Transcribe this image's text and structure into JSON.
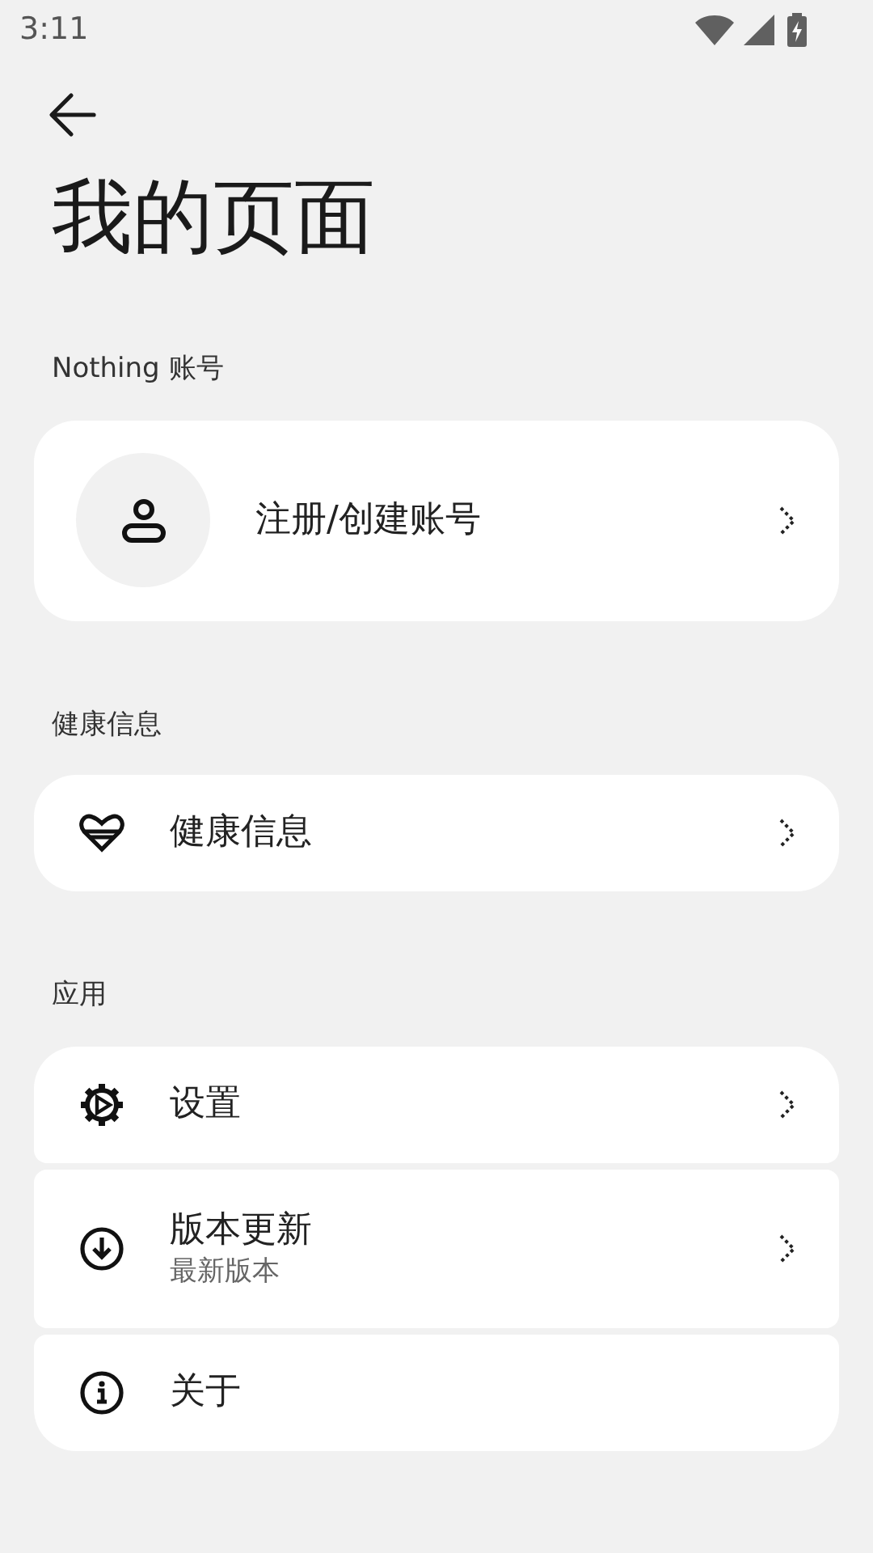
{
  "status_bar": {
    "time": "3:11"
  },
  "title": "我的页面",
  "sections": [
    {
      "label": "Nothing 账号",
      "items": [
        {
          "kind": "account",
          "label": "注册/创建账号"
        }
      ]
    },
    {
      "label": "健康信息",
      "items": [
        {
          "kind": "heart",
          "label": "健康信息"
        }
      ]
    },
    {
      "label": "应用",
      "items": [
        {
          "kind": "gear",
          "label": "设置"
        },
        {
          "kind": "download",
          "label": "版本更新",
          "subtitle": "最新版本"
        },
        {
          "kind": "info",
          "label": "关于"
        }
      ]
    }
  ]
}
